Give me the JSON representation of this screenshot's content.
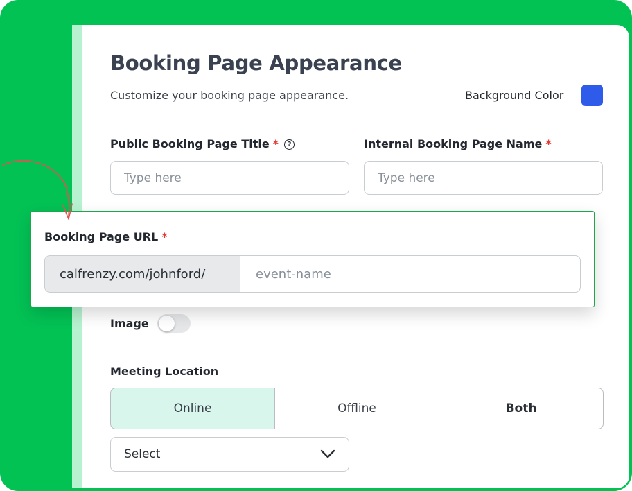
{
  "page": {
    "title": "Booking Page Appearance",
    "subtitle": "Customize your booking page appearance.",
    "background_color_label": "Background Color",
    "background_color_value": "#2f5bea"
  },
  "fields": {
    "public_title": {
      "label": "Public Booking Page Title",
      "required_mark": "*",
      "help_icon": "question-circle-icon",
      "placeholder": "Type here"
    },
    "internal_name": {
      "label": "Internal Booking Page Name",
      "required_mark": "*",
      "placeholder": "Type here"
    },
    "url": {
      "label": "Booking Page URL",
      "required_mark": "*",
      "prefix": "calfrenzy.com/johnford/",
      "placeholder": "event-name"
    },
    "image": {
      "label": "Image",
      "toggle_on": false
    },
    "meeting_location": {
      "label": "Meeting Location",
      "options": [
        "Online",
        "Offline",
        "Both"
      ],
      "selected": "Online",
      "select_value": "Select",
      "select_icon": "chevron-down-icon"
    }
  },
  "colors": {
    "brand_green": "#03c254",
    "accent_strip": "#b7f2d0",
    "active_segment": "#d8f6ec",
    "required": "#e53935",
    "annotation_arrow": "#e05252"
  }
}
